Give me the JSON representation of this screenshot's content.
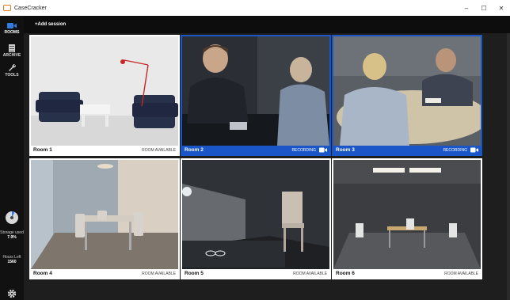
{
  "app": {
    "title": "CaseCracker",
    "accent": "#1a56c8"
  },
  "window_controls": {
    "minimize": "‒",
    "maximize": "☐",
    "close": "✕"
  },
  "sidebar": {
    "items": [
      {
        "label": "ROOMS",
        "icon": "camera-icon",
        "active": true
      },
      {
        "label": "ARCHIVE",
        "icon": "archive-icon",
        "active": false
      },
      {
        "label": "TOOLS",
        "icon": "wrench-icon",
        "active": false
      }
    ],
    "storage": {
      "label": "Storage used",
      "value": "7.9%",
      "fraction": 0.079
    },
    "hours": {
      "label": "Hours Left",
      "value": "1560"
    },
    "settings_icon": "gear-icon"
  },
  "topbar": {
    "add_session": "+Add session"
  },
  "rooms": [
    {
      "name": "Room 1",
      "status": "ROOM AVAILABLE",
      "recording": false,
      "scene": "living-room"
    },
    {
      "name": "Room 2",
      "status": "RECORDING",
      "recording": true,
      "scene": "interrogation"
    },
    {
      "name": "Room 3",
      "status": "RECORDING",
      "recording": true,
      "scene": "meeting"
    },
    {
      "name": "Room 4",
      "status": "ROOM AVAILABLE",
      "recording": false,
      "scene": "dining"
    },
    {
      "name": "Room 5",
      "status": "ROOM AVAILABLE",
      "recording": false,
      "scene": "dark-interview"
    },
    {
      "name": "Room 6",
      "status": "ROOM AVAILABLE",
      "recording": false,
      "scene": "empty-room"
    }
  ]
}
